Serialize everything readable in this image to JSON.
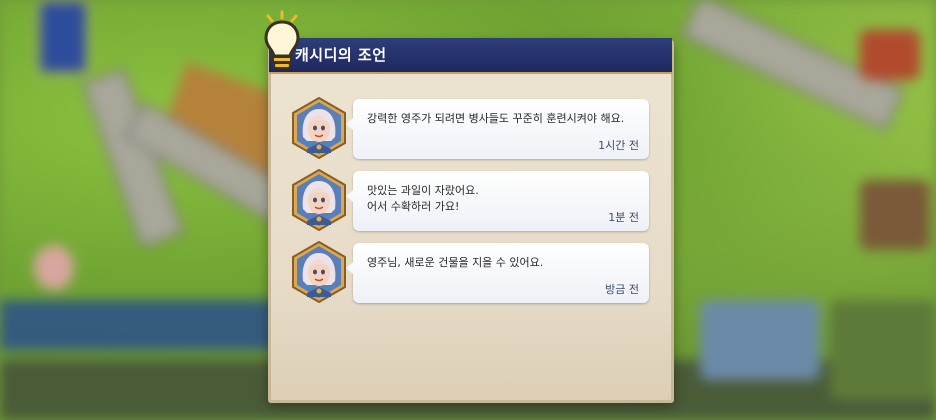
{
  "panel": {
    "title": "캐시디의 조언"
  },
  "messages": [
    {
      "text": "강력한 영주가 되려면 병사들도 꾸준히 훈련시켜야 해요.",
      "time": "1시간 전"
    },
    {
      "text": "맛있는 과일이 자랐어요.\n어서 수확하러 가요!",
      "time": "1분 전"
    },
    {
      "text": "영주님, 새로운 건물을 지을 수 있어요.",
      "time": "방금 전"
    }
  ],
  "icons": {
    "title_icon": "lightbulb-icon",
    "avatar": "advisor-portrait"
  },
  "colors": {
    "title_bar": "#1d2860",
    "panel_bg": "#ede4d3",
    "time_text": "#3c4a6e"
  }
}
